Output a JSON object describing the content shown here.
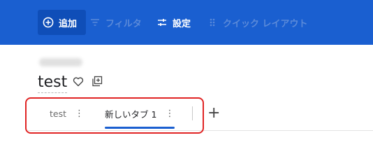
{
  "toolbar": {
    "add_label": "追加",
    "filter_label": "フィルタ",
    "settings_label": "設定",
    "quick_layout_label": "クイック レイアウト"
  },
  "page": {
    "title": "test"
  },
  "tabs": [
    {
      "label": "test",
      "active": false
    },
    {
      "label": "新しいタブ 1",
      "active": true
    }
  ],
  "tab_menu_glyph": "⋮",
  "add_tab_glyph": "+",
  "colors": {
    "toolbar_bg": "#1a5fd0",
    "active_tab_accent": "#1a5fd0",
    "highlight_border": "#e02424"
  }
}
